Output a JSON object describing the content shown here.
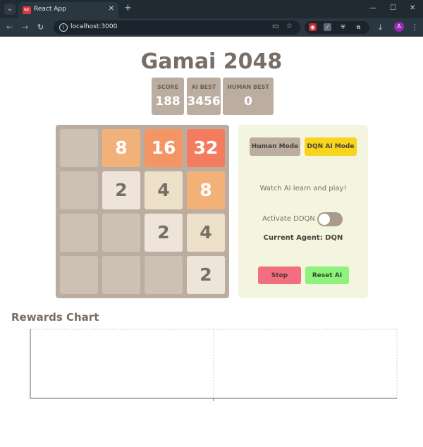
{
  "browser": {
    "tab_title": "React App",
    "url": "localhost:3000",
    "profile_initial": "A"
  },
  "game": {
    "title": "Gamai 2048",
    "scores": [
      {
        "label": "SCORE",
        "value": "188"
      },
      {
        "label": "AI BEST",
        "value": "3456"
      },
      {
        "label": "HUMAN BEST",
        "value": "0"
      }
    ],
    "grid": [
      [
        null,
        8,
        16,
        32
      ],
      [
        null,
        2,
        4,
        8
      ],
      [
        null,
        null,
        2,
        4
      ],
      [
        null,
        null,
        null,
        2
      ]
    ],
    "tile_colors": {
      "2": {
        "bg": "#eee4da",
        "fg": "#776e65"
      },
      "4": {
        "bg": "#ede0c8",
        "fg": "#776e65"
      },
      "8": {
        "bg": "#f2b179",
        "fg": "#ffffff"
      },
      "16": {
        "bg": "#f59563",
        "fg": "#ffffff"
      },
      "32": {
        "bg": "#f67c5f",
        "fg": "#ffffff"
      }
    }
  },
  "controls": {
    "human_mode_label": "Human Mode",
    "ai_mode_label": "DQN AI Mode",
    "status_text": "Watch AI learn and play!",
    "ddqn_label": "Activate DDQN",
    "ddqn_active": false,
    "current_agent_text": "Current Agent: DQN",
    "stop_label": "Stop",
    "reset_label": "Reset AI"
  },
  "chart": {
    "heading": "Rewards Chart"
  },
  "chart_data": {
    "type": "line",
    "title": "",
    "series": [],
    "x": [],
    "grid": true
  }
}
